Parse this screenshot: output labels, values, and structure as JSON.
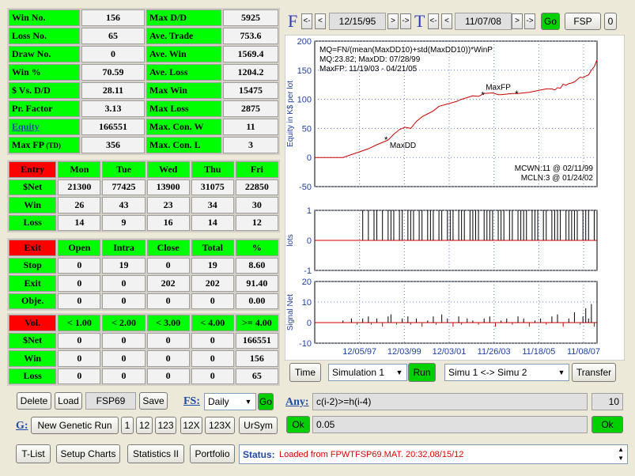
{
  "stats": {
    "rows": [
      {
        "l1": "Win No.",
        "v1": "156",
        "l2": "Max D/D",
        "v2": "5925"
      },
      {
        "l1": "Loss No.",
        "v1": "65",
        "l2": "Ave. Trade",
        "v2": "753.6"
      },
      {
        "l1": "Draw No.",
        "v1": "0",
        "l2": "Ave. Win",
        "v2": "1569.4"
      },
      {
        "l1": "Win %",
        "v1": "70.59",
        "l2": "Ave. Loss",
        "v2": "1204.2"
      },
      {
        "l1": "$ Vs. D/D",
        "v1": "28.11",
        "l2": "Max Win",
        "v2": "15475"
      },
      {
        "l1": "Pr. Factor",
        "v1": "3.13",
        "l2": "Max Loss",
        "v2": "2875"
      },
      {
        "l1": "Equity",
        "v1": "166551",
        "l2": "Max. Con. W",
        "v2": "11"
      },
      {
        "l1": "Max FP",
        "l1s": "(TD)",
        "v1": "356",
        "l2": "Max. Con. L",
        "v2": "3"
      }
    ]
  },
  "entry": {
    "header": [
      "Entry",
      "Mon",
      "Tue",
      "Wed",
      "Thu",
      "Fri"
    ],
    "rows": [
      [
        "$Net",
        "21300",
        "77425",
        "13900",
        "31075",
        "22850"
      ],
      [
        "Win",
        "26",
        "43",
        "23",
        "34",
        "30"
      ],
      [
        "Loss",
        "14",
        "9",
        "16",
        "14",
        "12"
      ]
    ]
  },
  "exit": {
    "header": [
      "Exit",
      "Open",
      "Intra",
      "Close",
      "Total",
      "%"
    ],
    "rows": [
      [
        "Stop",
        "0",
        "19",
        "0",
        "19",
        "8.60"
      ],
      [
        "Exit",
        "0",
        "0",
        "202",
        "202",
        "91.40"
      ],
      [
        "Obje.",
        "0",
        "0",
        "0",
        "0",
        "0.00"
      ]
    ]
  },
  "vol": {
    "header": [
      "Vol.",
      "< 1.00",
      "< 2.00",
      "< 3.00",
      "< 4.00",
      ">= 4.00"
    ],
    "rows": [
      [
        "$Net",
        "0",
        "0",
        "0",
        "0",
        "166551"
      ],
      [
        "Win",
        "0",
        "0",
        "0",
        "0",
        "156"
      ],
      [
        "Loss",
        "0",
        "0",
        "0",
        "0",
        "65"
      ]
    ]
  },
  "controls": {
    "delete": "Delete",
    "load": "Load",
    "file": "FSP69",
    "save": "Save",
    "fs_label": "FS:",
    "fs_value": "Daily",
    "go": "Go",
    "g_label": "G:",
    "genetic": "New Genetic Run",
    "b1": "1",
    "b12": "12",
    "b123": "123",
    "b12x": "12X",
    "b123x": "123X",
    "ursym": "UrSym",
    "tlist": "T-List",
    "setup": "Setup Charts",
    "stats2": "Statistics II",
    "portfolio": "Portfolio",
    "status_label": "Status:",
    "status_text": "Loaded from FPWTFSP69.MAT. 20:32,08/15/12"
  },
  "topbar": {
    "f": "F",
    "t": "T",
    "from": "12/15/95",
    "to": "11/07/08",
    "go": "Go",
    "sym": "FSP",
    "zero": "0",
    "lt": "<",
    "ltlt": "<-",
    "gt": ">",
    "gtgt": "->"
  },
  "sim": {
    "time": "Time",
    "sim1": "Simulation 1",
    "run": "Run",
    "simx": "Simu 1 <-> Simu 2",
    "transfer": "Transfer"
  },
  "any": {
    "label": "Any:",
    "expr": "c(i-2)>=h(i-4)",
    "n": "10",
    "ok": "Ok",
    "val": "0.05"
  },
  "chart_data": {
    "type": "line",
    "annotation_lines": [
      "MQ=FN/(mean(MaxDD10)+std(MaxDD10))*WinP",
      "MQ:23.82; MaxDD: 07/28/99",
      "MaxFP: 11/19/03 - 04/21/05"
    ],
    "corner_notes": [
      "MCWN:11 @ 02/11/99",
      "MCLN:3 @ 01/24/02"
    ],
    "marker_labels": [
      "MaxDD",
      "MaxFP"
    ],
    "ylabel_equity": "Equity in K$ per lot",
    "ylabel_lots": "lots",
    "ylabel_signal": "Signal Net",
    "equity_yticks": [
      "200",
      "150",
      "100",
      "50",
      "0",
      "-50"
    ],
    "lots_yticks": [
      "1",
      "0",
      "-1"
    ],
    "signal_yticks": [
      "20",
      "10",
      "0",
      "-10"
    ],
    "xticks": [
      "12/05/97",
      "12/03/99",
      "12/03/01",
      "11/26/03",
      "11/18/05",
      "11/08/07"
    ],
    "equity_ylim": [
      -50,
      200
    ],
    "equity_x": [
      0,
      5,
      10,
      13,
      16,
      19,
      22,
      26,
      28,
      30,
      32,
      34,
      36,
      38,
      40,
      42,
      44,
      47,
      50,
      52,
      54,
      56,
      58,
      60,
      63,
      65,
      66,
      68,
      70,
      72,
      74,
      76,
      78,
      80,
      82,
      84,
      85,
      86,
      87,
      88,
      89,
      90,
      91,
      92,
      93,
      94,
      95,
      96,
      97,
      98,
      99,
      100
    ],
    "equity_y": [
      0,
      0,
      0,
      5,
      10,
      15,
      22,
      30,
      40,
      48,
      52,
      50,
      62,
      70,
      75,
      80,
      88,
      92,
      96,
      100,
      103,
      106,
      105,
      110,
      111,
      108,
      108,
      109,
      110,
      110,
      111,
      112,
      114,
      116,
      118,
      118,
      116,
      120,
      119,
      126,
      124,
      127,
      128,
      130,
      134,
      138,
      137,
      140,
      142,
      150,
      156,
      168
    ],
    "lots_bar_x": [
      17,
      19,
      21,
      22,
      24,
      26,
      27,
      28,
      30,
      31,
      33,
      34,
      35,
      37,
      38,
      40,
      41,
      42,
      44,
      45,
      47,
      48,
      49,
      51,
      52,
      53,
      55,
      56,
      57,
      58,
      60,
      61,
      62,
      63,
      65,
      66,
      67,
      69,
      70,
      72,
      73,
      74,
      75,
      77,
      78,
      79,
      81,
      82,
      84,
      85,
      86,
      87,
      89,
      90,
      91,
      92,
      93,
      95,
      96,
      97,
      99
    ],
    "signal_x": [
      10,
      13,
      15,
      17,
      19,
      20,
      22,
      24,
      26,
      27,
      29,
      31,
      33,
      34,
      36,
      38,
      40,
      42,
      43,
      45,
      47,
      49,
      51,
      52,
      54,
      56,
      58,
      60,
      62,
      64,
      66,
      68,
      70,
      72,
      74,
      76,
      78,
      80,
      82,
      84,
      86,
      88,
      90,
      92,
      94,
      95,
      96,
      97,
      98,
      99,
      100
    ],
    "signal_y": [
      1,
      2,
      -1,
      2,
      3,
      -1,
      2,
      -2,
      3,
      4,
      -1,
      2,
      3,
      -1,
      2,
      -2,
      1,
      3,
      -1,
      4,
      2,
      -2,
      3,
      -1,
      2,
      1,
      -1,
      2,
      3,
      -2,
      1,
      2,
      -1,
      3,
      2,
      -2,
      1,
      2,
      -1,
      3,
      4,
      -2,
      2,
      5,
      -1,
      3,
      7,
      2,
      9,
      -2,
      15
    ]
  }
}
